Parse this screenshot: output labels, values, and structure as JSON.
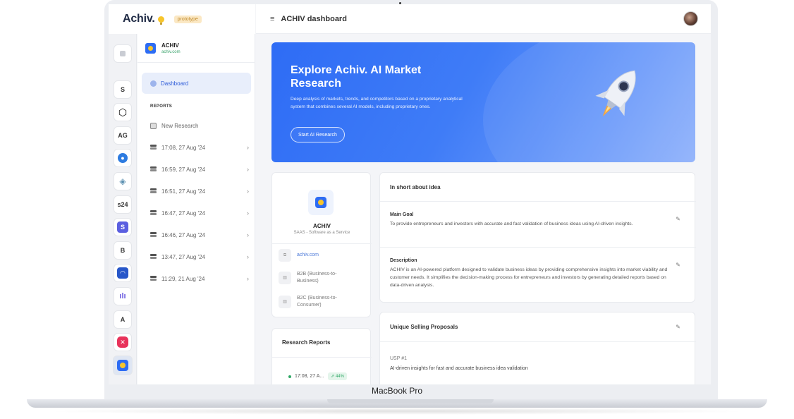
{
  "device_label": "MacBook Pro",
  "brand": {
    "name": "Achiv.",
    "badge": "prototype"
  },
  "rail": {
    "items": [
      "S",
      "AG",
      "s24",
      "B",
      "A"
    ]
  },
  "sidebar": {
    "app_name": "ACHIV",
    "app_url": "achiv.com",
    "dashboard_label": "Dashboard",
    "reports_heading": "REPORTS",
    "new_research_label": "New Research",
    "reports": [
      "17:08, 27 Aug '24",
      "16:59, 27 Aug '24",
      "16:51, 27 Aug '24",
      "16:47, 27 Aug '24",
      "16:46, 27 Aug '24",
      "13:47, 27 Aug '24",
      "11:29, 21 Aug '24"
    ],
    "chevron": "›"
  },
  "topbar": {
    "menu_icon": "≡",
    "title": "ACHIV dashboard"
  },
  "hero": {
    "title": "Explore Achiv. AI Market Research",
    "description": "Deep analysis of markets, trends, and competitors based on a proprietary analytical system that combines several AI models, including proprietary ones.",
    "button_label": "Start AI Research"
  },
  "profile": {
    "name": "ACHIV",
    "subtitle": "SAAS - Software as a Service",
    "link": "achiv.com",
    "tags": [
      "B2B (Business-to-Business)",
      "B2C (Business-to-Consumer)"
    ]
  },
  "research_reports": {
    "title": "Research Reports",
    "first_item": "17:08, 27 A...",
    "first_progress": "44%",
    "progress_value": 44
  },
  "idea": {
    "title": "In short about idea",
    "main_goal_label": "Main Goal",
    "main_goal_text": "To provide entrepreneurs and investors with accurate and fast validation of business ideas using AI-driven insights.",
    "description_label": "Description",
    "description_text": "ACHIV is an AI-powered platform designed to validate business ideas by providing comprehensive insights into market viability and customer needs. It simplifies the decision-making process for entrepreneurs and investors by generating detailed reports based on data-driven analysis."
  },
  "usp": {
    "title": "Unique Selling Proposals",
    "item_label": "USP #1",
    "item_text": "AI-driven insights for fast and accurate business idea validation"
  },
  "colors": {
    "accent": "#2e6cf5",
    "success": "#2fa866",
    "bulb": "#f7c52c"
  }
}
